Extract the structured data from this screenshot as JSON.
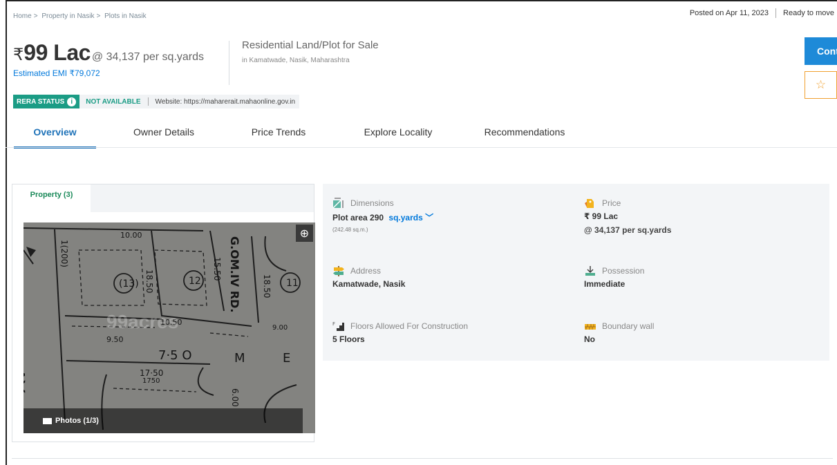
{
  "breadcrumb": {
    "items": [
      "Home",
      "Property in Nasik",
      "Plots in Nasik"
    ],
    "sep": ">"
  },
  "posted": {
    "date": "Posted on Apr 11, 2023",
    "status": "Ready to move"
  },
  "price": {
    "symbol": "₹",
    "value": "99 Lac",
    "per_unit": "@ 34,137 per sq.yards",
    "emi": "Estimated EMI ₹79,072"
  },
  "property": {
    "title": "Residential Land/Plot for Sale",
    "location": "in Kamatwade, Nasik, Maharashtra"
  },
  "rera": {
    "badge": "RERA STATUS",
    "status": "NOT AVAILABLE",
    "website": "Website: https://maharerait.mahaonline.gov.in"
  },
  "actions": {
    "contact_label": "Cont",
    "shortlist_icon": "star-outline-icon"
  },
  "tabs": [
    {
      "label": "Overview",
      "active": true
    },
    {
      "label": "Owner Details",
      "active": false
    },
    {
      "label": "Price Trends",
      "active": false
    },
    {
      "label": "Explore Locality",
      "active": false
    },
    {
      "label": "Recommendations",
      "active": false
    }
  ],
  "gallery": {
    "tab_label": "Property (3)",
    "photos_label": "Photos (1/3)",
    "watermark": "99acres"
  },
  "details": {
    "dimensions": {
      "label": "Dimensions",
      "value": "Plot area 290",
      "unit": "sq.yards",
      "sub": "(242.48 sq.m.)"
    },
    "price": {
      "label": "Price",
      "value": "₹ 99 Lac",
      "sub": "@ 34,137 per sq.yards"
    },
    "address": {
      "label": "Address",
      "value": "Kamatwade, Nasik"
    },
    "possession": {
      "label": "Possession",
      "value": "Immediate"
    },
    "floors": {
      "label": "Floors Allowed For Construction",
      "value": "5 Floors"
    },
    "boundary": {
      "label": "Boundary wall",
      "value": "No"
    }
  },
  "colors": {
    "accent": "#1e72b8",
    "link": "#0078db",
    "rera": "#1b9c85",
    "star": "#f0a030"
  }
}
